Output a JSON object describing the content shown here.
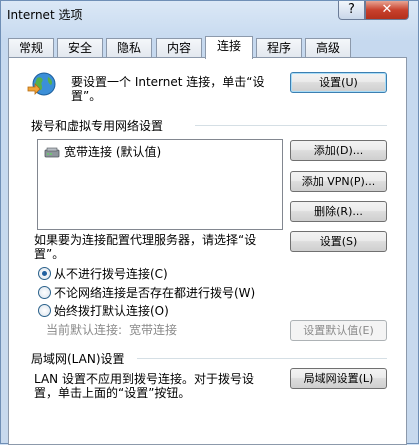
{
  "window": {
    "title": "Internet 选项",
    "help_label": "?",
    "close_label": "✕"
  },
  "tabs": [
    {
      "label": "常规"
    },
    {
      "label": "安全"
    },
    {
      "label": "隐私"
    },
    {
      "label": "内容"
    },
    {
      "label": "连接"
    },
    {
      "label": "程序"
    },
    {
      "label": "高级"
    }
  ],
  "active_tab": "连接",
  "setup": {
    "icon": "globe-network-icon",
    "text_line1": "要设置一个 Internet 连接，单击“设",
    "text_line2": "置”。",
    "button": "设置(U)"
  },
  "dialup": {
    "group_title": "拨号和虚拟专用网络设置",
    "items": [
      {
        "icon": "modem-icon",
        "label": "宽带连接 (默认值)"
      }
    ],
    "add_button": "添加(D)...",
    "add_vpn_button": "添加 VPN(P)...",
    "delete_button": "删除(R)...",
    "proxy_text_line1": "如果要为连接配置代理服务器，请选择“设",
    "proxy_text_line2": "置”。",
    "settings_button": "设置(S)",
    "options": [
      {
        "label": "从不进行拨号连接(C)",
        "checked": true
      },
      {
        "label": "不论网络连接是否存在都进行拨号(W)",
        "checked": false
      },
      {
        "label": "始终拨打默认连接(O)",
        "checked": false
      }
    ],
    "current_default_label": "当前默认连接:",
    "current_default_value": "宽带连接",
    "set_default_button": "设置默认值(E)"
  },
  "lan": {
    "group_title": "局域网(LAN)设置",
    "text_line1": "LAN 设置不应用到拨号连接。对于拨号设",
    "text_line2": "置，单击上面的“设置”按钮。",
    "button": "局域网设置(L)"
  },
  "colors": {
    "accent": "#3c7fb1",
    "close": "#c8412d"
  }
}
